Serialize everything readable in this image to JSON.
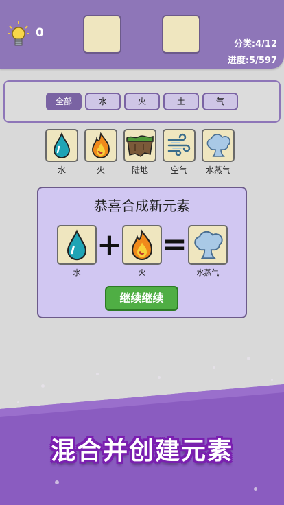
{
  "header": {
    "hint_count": "0",
    "category_stat": "分类:4/12",
    "progress_stat": "进度:5/597"
  },
  "filters": [
    "全部",
    "水",
    "火",
    "土",
    "气"
  ],
  "elements": [
    {
      "label": "水",
      "icon": "water-drop-icon"
    },
    {
      "label": "火",
      "icon": "fire-icon"
    },
    {
      "label": "陆地",
      "icon": "land-icon"
    },
    {
      "label": "空气",
      "icon": "wind-icon"
    },
    {
      "label": "水蒸气",
      "icon": "steam-cloud-icon"
    }
  ],
  "dialog": {
    "title": "恭喜合成新元素",
    "input1_label": "水",
    "input2_label": "火",
    "result_label": "水蒸气",
    "plus": "+",
    "equals": "=",
    "continue_label": "继续继续"
  },
  "banner": "混合并创建元素",
  "colors": {
    "accent": "#8e76b8",
    "dialog_bg": "#d1c7f2",
    "tile_bg": "#efe6bf",
    "continue_green": "#4fae44",
    "footer_purple": "#8a5cc0"
  }
}
